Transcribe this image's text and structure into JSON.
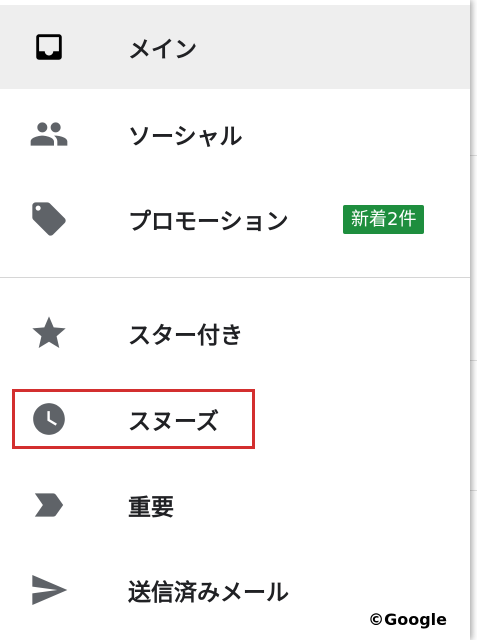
{
  "drawer": {
    "items": [
      {
        "label": "メイン",
        "icon": "inbox-icon",
        "selected": true
      },
      {
        "label": "ソーシャル",
        "icon": "people-icon"
      },
      {
        "label": "プロモーション",
        "icon": "tag-icon",
        "badge": "新着2件"
      },
      {
        "label": "スター付き",
        "icon": "star-icon"
      },
      {
        "label": "スヌーズ",
        "icon": "clock-icon",
        "highlighted": true
      },
      {
        "label": "重要",
        "icon": "important-icon"
      },
      {
        "label": "送信済みメール",
        "icon": "send-icon"
      }
    ]
  },
  "colors": {
    "icon": "#5f6368",
    "selected_bg": "#eeeeee",
    "badge_bg": "#1e8e3e",
    "highlight_border": "#d32f2f"
  },
  "copyright": "©Google"
}
